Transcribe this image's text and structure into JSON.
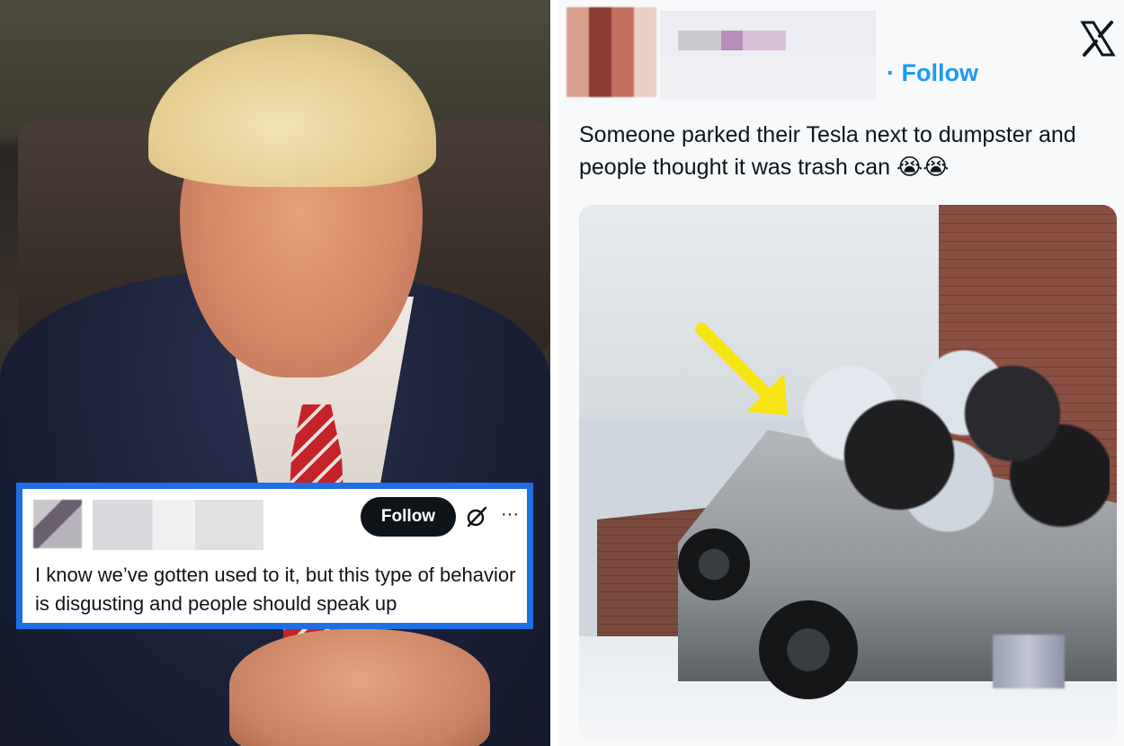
{
  "quote_card": {
    "follow_label": "Follow",
    "more_symbol": "···",
    "text": "I know we’ve gotten used to it, but this type of behavior is disgusting and people should speak up"
  },
  "tweet": {
    "follow_label": "· Follow",
    "text": "Someone parked their Tesla next to dumpster and people thought it was trash can 😭😭",
    "photo_alt": "Cybertruck parked next to an overflowing dumpster"
  },
  "colors": {
    "highlight_border": "#1e6fe3",
    "follow_blue": "#1d9bf0",
    "button_black": "#0f1419",
    "arrow_yellow": "#f7e514"
  },
  "icons": [
    "grok-icon",
    "more-icon",
    "x-logo-icon",
    "arrow-annotation"
  ]
}
